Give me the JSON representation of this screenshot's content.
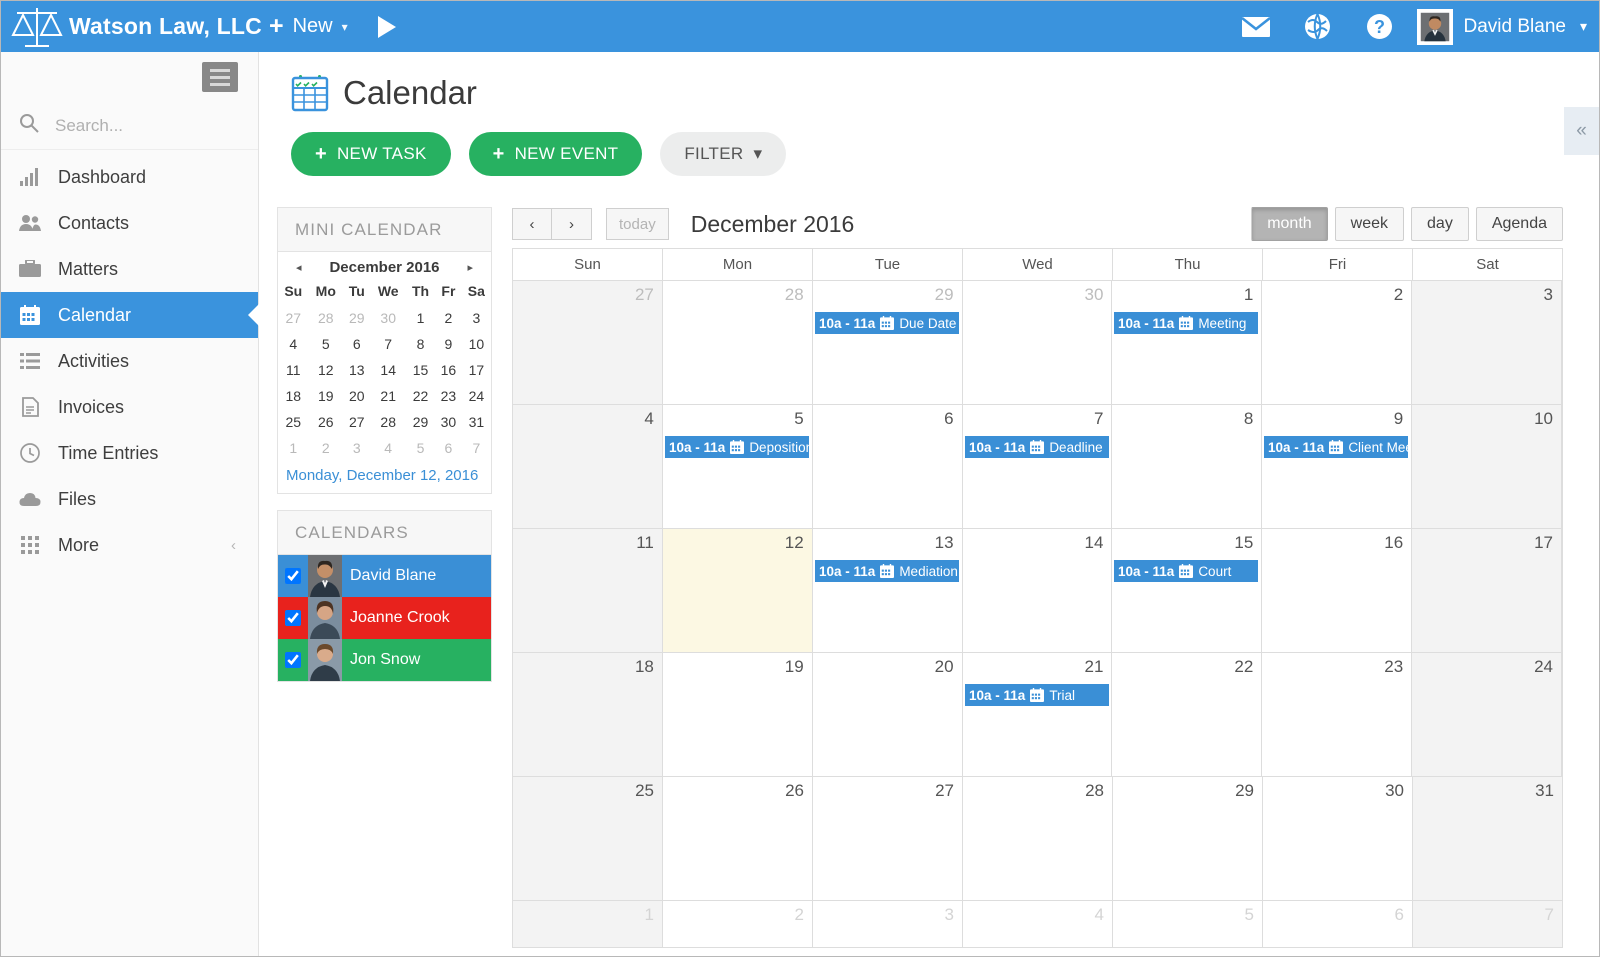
{
  "topbar": {
    "brand": "Watson Law, LLC",
    "brand_icon": "scales-of-justice-icon",
    "new_label": "New",
    "new_plus": "+",
    "caret": "⌄",
    "play_icon": "play-icon",
    "mail_icon": "envelope-icon",
    "globe_icon": "globe-icon",
    "help_icon": "question-circle-icon",
    "user_name": "David Blane",
    "user_caret": "⌄",
    "accent_color": "#3a93dd"
  },
  "sidebar": {
    "hamburger_icon": "hamburger-menu-icon",
    "search_placeholder": "Search...",
    "search_value": "",
    "search_icon": "search-icon",
    "items": [
      {
        "label": "Dashboard",
        "icon": "bar-chart-icon",
        "active": false
      },
      {
        "label": "Contacts",
        "icon": "users-icon",
        "active": false
      },
      {
        "label": "Matters",
        "icon": "briefcase-icon",
        "active": false
      },
      {
        "label": "Calendar",
        "icon": "calendar-icon",
        "active": true
      },
      {
        "label": "Activities",
        "icon": "list-icon",
        "active": false
      },
      {
        "label": "Invoices",
        "icon": "file-text-icon",
        "active": false
      },
      {
        "label": "Time Entries",
        "icon": "clock-icon",
        "active": false
      },
      {
        "label": "Files",
        "icon": "cloud-icon",
        "active": false
      },
      {
        "label": "More",
        "icon": "grid-icon",
        "active": false,
        "chevron": "‹"
      }
    ]
  },
  "page": {
    "title": "Calendar",
    "title_icon": "calendar-icon",
    "new_task_label": "NEW TASK",
    "new_event_label": "NEW EVENT",
    "filter_label": "FILTER",
    "filter_caret": "▾",
    "collapse_icon": "chevron-double-left-icon",
    "collapse_glyph": "«",
    "green": "#27b161"
  },
  "mini_calendar": {
    "panel_title": "MINI CALENDAR",
    "prev_glyph": "◂",
    "next_glyph": "▸",
    "month_title": "December 2016",
    "dow": [
      "Su",
      "Mo",
      "Tu",
      "We",
      "Th",
      "Fr",
      "Sa"
    ],
    "weeks": [
      [
        {
          "d": "27",
          "o": true
        },
        {
          "d": "28",
          "o": true
        },
        {
          "d": "29",
          "o": true
        },
        {
          "d": "30",
          "o": true
        },
        {
          "d": "1",
          "o": false
        },
        {
          "d": "2",
          "o": false
        },
        {
          "d": "3",
          "o": false
        }
      ],
      [
        {
          "d": "4",
          "o": false
        },
        {
          "d": "5",
          "o": false
        },
        {
          "d": "6",
          "o": false
        },
        {
          "d": "7",
          "o": false
        },
        {
          "d": "8",
          "o": false
        },
        {
          "d": "9",
          "o": false
        },
        {
          "d": "10",
          "o": false
        }
      ],
      [
        {
          "d": "11",
          "o": false
        },
        {
          "d": "12",
          "o": false
        },
        {
          "d": "13",
          "o": false
        },
        {
          "d": "14",
          "o": false
        },
        {
          "d": "15",
          "o": false
        },
        {
          "d": "16",
          "o": false
        },
        {
          "d": "17",
          "o": false
        }
      ],
      [
        {
          "d": "18",
          "o": false
        },
        {
          "d": "19",
          "o": false
        },
        {
          "d": "20",
          "o": false
        },
        {
          "d": "21",
          "o": false
        },
        {
          "d": "22",
          "o": false
        },
        {
          "d": "23",
          "o": false
        },
        {
          "d": "24",
          "o": false
        }
      ],
      [
        {
          "d": "25",
          "o": false
        },
        {
          "d": "26",
          "o": false
        },
        {
          "d": "27",
          "o": false
        },
        {
          "d": "28",
          "o": false
        },
        {
          "d": "29",
          "o": false
        },
        {
          "d": "30",
          "o": false
        },
        {
          "d": "31",
          "o": false
        }
      ],
      [
        {
          "d": "1",
          "o": true
        },
        {
          "d": "2",
          "o": true
        },
        {
          "d": "3",
          "o": true
        },
        {
          "d": "4",
          "o": true
        },
        {
          "d": "5",
          "o": true
        },
        {
          "d": "6",
          "o": true
        },
        {
          "d": "7",
          "o": true
        }
      ]
    ],
    "selected_date_text": "Monday, December 12, 2016"
  },
  "calendars_panel": {
    "panel_title": "CALENDARS",
    "entries": [
      {
        "name": "David Blane",
        "color": "#3a8fd6",
        "checked": true
      },
      {
        "name": "Joanne Crook",
        "color": "#e8221d",
        "checked": true
      },
      {
        "name": "Jon Snow",
        "color": "#27b161",
        "checked": true
      }
    ]
  },
  "calendar": {
    "prev_glyph": "‹",
    "next_glyph": "›",
    "today_label": "today",
    "heading": "December 2016",
    "views": [
      {
        "label": "month",
        "active": true
      },
      {
        "label": "week",
        "active": false
      },
      {
        "label": "day",
        "active": false
      },
      {
        "label": "Agenda",
        "active": false
      }
    ],
    "day_names": [
      "Sun",
      "Mon",
      "Tue",
      "Wed",
      "Thu",
      "Fri",
      "Sat"
    ],
    "weeks": [
      {
        "days": [
          {
            "num": "27",
            "other": true,
            "weekend": true
          },
          {
            "num": "28",
            "other": true,
            "weekend": false
          },
          {
            "num": "29",
            "other": true,
            "weekend": false
          },
          {
            "num": "30",
            "other": true,
            "weekend": false
          },
          {
            "num": "1",
            "other": false,
            "weekend": false
          },
          {
            "num": "2",
            "other": false,
            "weekend": false
          },
          {
            "num": "3",
            "other": false,
            "weekend": true
          }
        ]
      },
      {
        "days": [
          {
            "num": "4",
            "other": false,
            "weekend": true
          },
          {
            "num": "5",
            "other": false,
            "weekend": false
          },
          {
            "num": "6",
            "other": false,
            "weekend": false
          },
          {
            "num": "7",
            "other": false,
            "weekend": false
          },
          {
            "num": "8",
            "other": false,
            "weekend": false
          },
          {
            "num": "9",
            "other": false,
            "weekend": false
          },
          {
            "num": "10",
            "other": false,
            "weekend": true
          }
        ]
      },
      {
        "days": [
          {
            "num": "11",
            "other": false,
            "weekend": true
          },
          {
            "num": "12",
            "other": false,
            "weekend": false,
            "today": true
          },
          {
            "num": "13",
            "other": false,
            "weekend": false
          },
          {
            "num": "14",
            "other": false,
            "weekend": false
          },
          {
            "num": "15",
            "other": false,
            "weekend": false
          },
          {
            "num": "16",
            "other": false,
            "weekend": false
          },
          {
            "num": "17",
            "other": false,
            "weekend": true
          }
        ]
      },
      {
        "days": [
          {
            "num": "18",
            "other": false,
            "weekend": true
          },
          {
            "num": "19",
            "other": false,
            "weekend": false
          },
          {
            "num": "20",
            "other": false,
            "weekend": false
          },
          {
            "num": "21",
            "other": false,
            "weekend": false
          },
          {
            "num": "22",
            "other": false,
            "weekend": false
          },
          {
            "num": "23",
            "other": false,
            "weekend": false
          },
          {
            "num": "24",
            "other": false,
            "weekend": true
          }
        ]
      },
      {
        "days": [
          {
            "num": "25",
            "other": false,
            "weekend": true
          },
          {
            "num": "26",
            "other": false,
            "weekend": false
          },
          {
            "num": "27",
            "other": false,
            "weekend": false
          },
          {
            "num": "28",
            "other": false,
            "weekend": false
          },
          {
            "num": "29",
            "other": false,
            "weekend": false
          },
          {
            "num": "30",
            "other": false,
            "weekend": false
          },
          {
            "num": "31",
            "other": false,
            "weekend": true
          }
        ]
      },
      {
        "last": true,
        "days": [
          {
            "num": "1",
            "other": true,
            "weekend": true
          },
          {
            "num": "2",
            "other": true,
            "weekend": false
          },
          {
            "num": "3",
            "other": true,
            "weekend": false
          },
          {
            "num": "4",
            "other": true,
            "weekend": false
          },
          {
            "num": "5",
            "other": true,
            "weekend": false
          },
          {
            "num": "6",
            "other": true,
            "weekend": false
          },
          {
            "num": "7",
            "other": true,
            "weekend": true
          }
        ]
      }
    ],
    "events": [
      {
        "week": 0,
        "col": 2,
        "time": "10a - 11a",
        "title": "Due Date",
        "color": "#3a8fd6",
        "icon": "calendar-icon"
      },
      {
        "week": 0,
        "col": 4,
        "time": "10a - 11a",
        "title": "Meeting",
        "color": "#3a8fd6",
        "icon": "calendar-icon"
      },
      {
        "week": 1,
        "col": 1,
        "time": "10a - 11a",
        "title": "Deposition",
        "color": "#3a8fd6",
        "icon": "calendar-icon"
      },
      {
        "week": 1,
        "col": 3,
        "time": "10a - 11a",
        "title": "Deadline",
        "color": "#3a8fd6",
        "icon": "calendar-icon"
      },
      {
        "week": 1,
        "col": 5,
        "time": "10a - 11a",
        "title": "Client Meeting",
        "color": "#3a8fd6",
        "icon": "calendar-icon"
      },
      {
        "week": 2,
        "col": 2,
        "time": "10a - 11a",
        "title": "Mediation",
        "color": "#3a8fd6",
        "icon": "calendar-icon"
      },
      {
        "week": 2,
        "col": 4,
        "time": "10a - 11a",
        "title": "Court",
        "color": "#3a8fd6",
        "icon": "calendar-icon"
      },
      {
        "week": 3,
        "col": 3,
        "time": "10a - 11a",
        "title": "Trial",
        "color": "#3a8fd6",
        "icon": "calendar-icon"
      }
    ]
  }
}
